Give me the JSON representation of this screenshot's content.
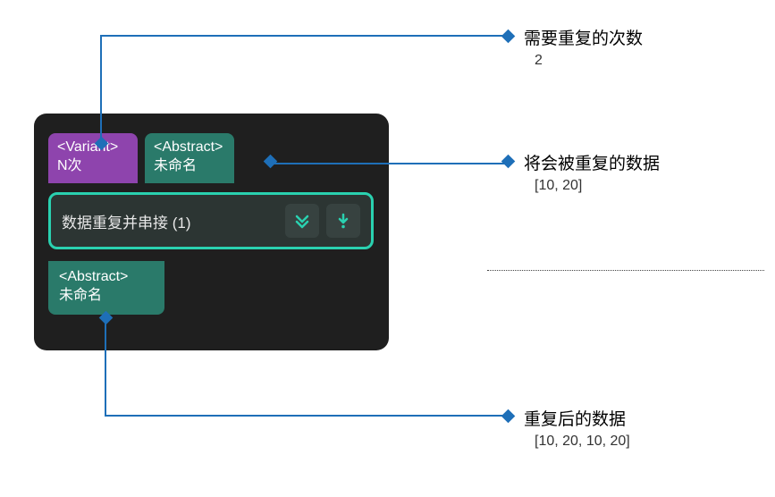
{
  "node": {
    "inputs": {
      "variant": {
        "tag": "<Variant>",
        "label": "N次"
      },
      "abstract": {
        "tag": "<Abstract>",
        "label": "未命名"
      }
    },
    "middle": {
      "label": "数据重复并串接 (1)"
    },
    "output": {
      "tag": "<Abstract>",
      "label": "未命名"
    }
  },
  "callouts": {
    "c1": {
      "title": "需要重复的次数",
      "value": "2"
    },
    "c2": {
      "title": "将会被重复的数据",
      "value": "[10, 20]"
    },
    "c3": {
      "title": "重复后的数据",
      "value": "[10, 20, 10, 20]"
    }
  }
}
